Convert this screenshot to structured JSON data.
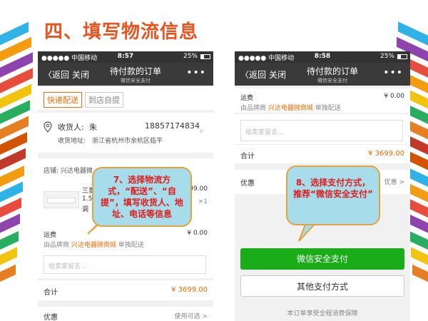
{
  "slide_title": "四、填写物流信息",
  "left_phone": {
    "status": {
      "carrier": "●●●●● 中国移动",
      "time": "8:57",
      "battery": "25%"
    },
    "nav": {
      "back": "〈返回",
      "close": "关闭",
      "title": "待付款的订单",
      "subtitle": "微信安全支付",
      "more": "•••"
    },
    "delivery_tabs": [
      "快递配送",
      "到店自提"
    ],
    "address": {
      "name_label": "收货人:",
      "name": "朱",
      "phone": "18857174834",
      "addr_label": "收货地址:",
      "addr": "浙江省杭州市余杭区临平"
    },
    "store": "店铺: 兴达电器微",
    "product": {
      "title_part": "三菱",
      "spec1": "1.5",
      "spec2": "调",
      "price_part": "99.00",
      "qty": "×1"
    },
    "shipping": {
      "label": "运费",
      "src_pre": "由品牌商",
      "src_store": "兴达电器微商城",
      "src_post": "单独配送",
      "fee": "¥ 0.00"
    },
    "msg_placeholder": "给卖家留言...",
    "total": {
      "label": "合计",
      "amount": "¥ 3699.00"
    },
    "next_row": {
      "left": "优惠",
      "right": "使用可选 >"
    },
    "callout": "7、选择物流方式，“配送”、“自提”，填写收货人、地址、电话等信息"
  },
  "right_phone": {
    "status": {
      "carrier": "●●●●● 中国移动",
      "time": "8:58",
      "battery": "25%"
    },
    "nav": {
      "back": "〈返回",
      "close": "关闭",
      "title": "待付款的订单",
      "subtitle": "微信安全支付",
      "more": "•••"
    },
    "shipping": {
      "label": "运费",
      "src_pre": "由品牌商",
      "src_store": "兴达电器微商城",
      "src_post": "单独配送",
      "fee": "¥ 0.00"
    },
    "msg_placeholder": "给卖家留言...",
    "total": {
      "label": "合计",
      "amount": "¥ 3699.00"
    },
    "discount": {
      "label": "优惠",
      "right": "优惠 >"
    },
    "callout": "8、选择支付方式，推荐“微信安全支付”",
    "pay_wechat": "微信安全支付",
    "pay_other": "其他支付方式",
    "footer": "本订单享受全程消费保障"
  }
}
